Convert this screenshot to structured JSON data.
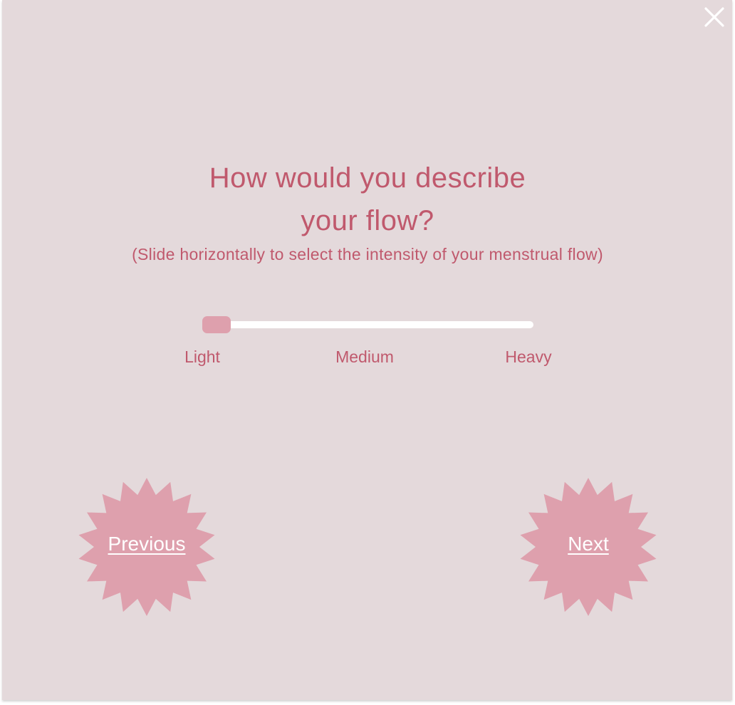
{
  "dialog": {
    "title_line1": "How would you describe",
    "title_line2": "your flow?",
    "subtitle": "(Slide horizontally to select the intensity of your menstrual flow)",
    "close_icon": "close-icon"
  },
  "slider": {
    "value": 0,
    "labels": [
      "Light",
      "Medium",
      "Heavy"
    ]
  },
  "buttons": {
    "previous_label": "Previous",
    "next_label": "Next",
    "shape": "starburst"
  },
  "colors": {
    "background": "#e4d9db",
    "accent_text": "#c0596d",
    "button_fill": "#dea0ad",
    "track": "#ffffff"
  }
}
